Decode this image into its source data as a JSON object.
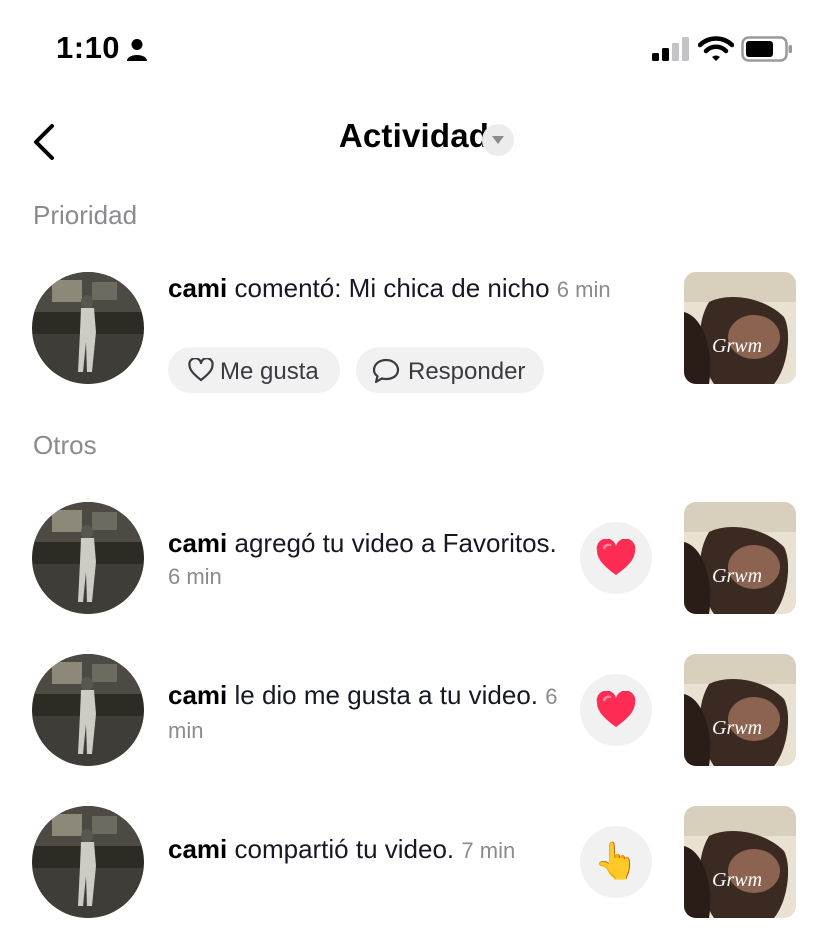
{
  "status_bar": {
    "time": "1:10"
  },
  "header": {
    "title": "Actividad"
  },
  "sections": {
    "priority": "Prioridad",
    "others": "Otros"
  },
  "priority_item": {
    "user": "cami",
    "action": " comentó: Mi chica de nicho ",
    "time": "6 min",
    "like_label": "Me gusta",
    "reply_label": "Responder",
    "thumb_caption": "Grwm"
  },
  "others": [
    {
      "user": "cami",
      "action": " agregó tu video a Favoritos. ",
      "time": "6 min",
      "reaction": "heart-icon",
      "thumb_caption": "Grwm"
    },
    {
      "user": "cami",
      "action": " le dio me gusta a tu video. ",
      "time": "6 min",
      "reaction": "heart-icon",
      "thumb_caption": "Grwm"
    },
    {
      "user": "cami",
      "action": " compartió tu video. ",
      "time": "7 min",
      "reaction": "pointing-hand-icon",
      "reaction_glyph": "👆",
      "thumb_caption": "Grwm"
    }
  ],
  "colors": {
    "heart": "#fe2c55",
    "secondary_text": "#8a8b91",
    "pill_bg": "#f1f1f2"
  }
}
